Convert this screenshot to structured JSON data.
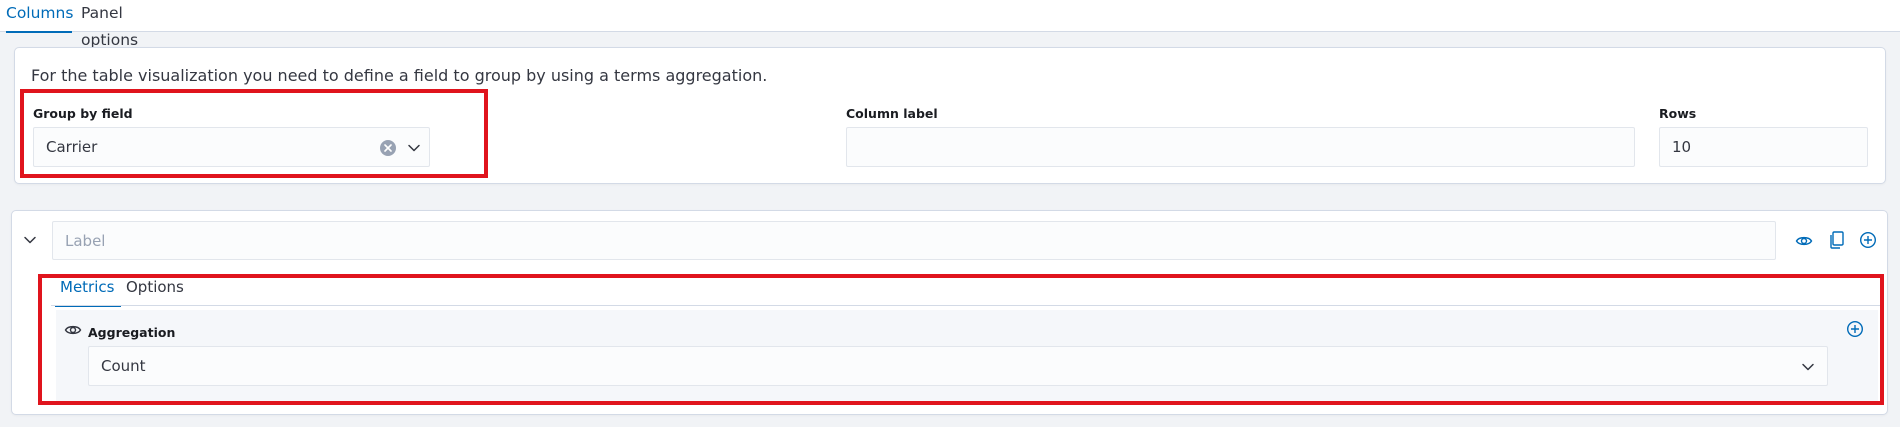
{
  "tabs": [
    {
      "label": "Columns",
      "active": true
    },
    {
      "label": "Panel options",
      "active": false
    }
  ],
  "group_panel": {
    "help_text": "For the table visualization you need to define a field to group by using a terms aggregation.",
    "group_by": {
      "label": "Group by field",
      "value": "Carrier"
    },
    "column_label": {
      "label": "Column label",
      "value": ""
    },
    "rows": {
      "label": "Rows",
      "value": "10"
    }
  },
  "column": {
    "label_placeholder": "Label",
    "actions": [
      "eye-icon",
      "copy-icon",
      "plus-circle-icon"
    ],
    "subtabs": [
      {
        "label": "Metrics",
        "active": true
      },
      {
        "label": "Options",
        "active": false
      }
    ],
    "aggregation": {
      "label": "Aggregation",
      "value": "Count"
    }
  },
  "colors": {
    "accent": "#006bb8",
    "highlight": "#e0141d",
    "text": "#343741",
    "muted": "#98a2b3"
  }
}
